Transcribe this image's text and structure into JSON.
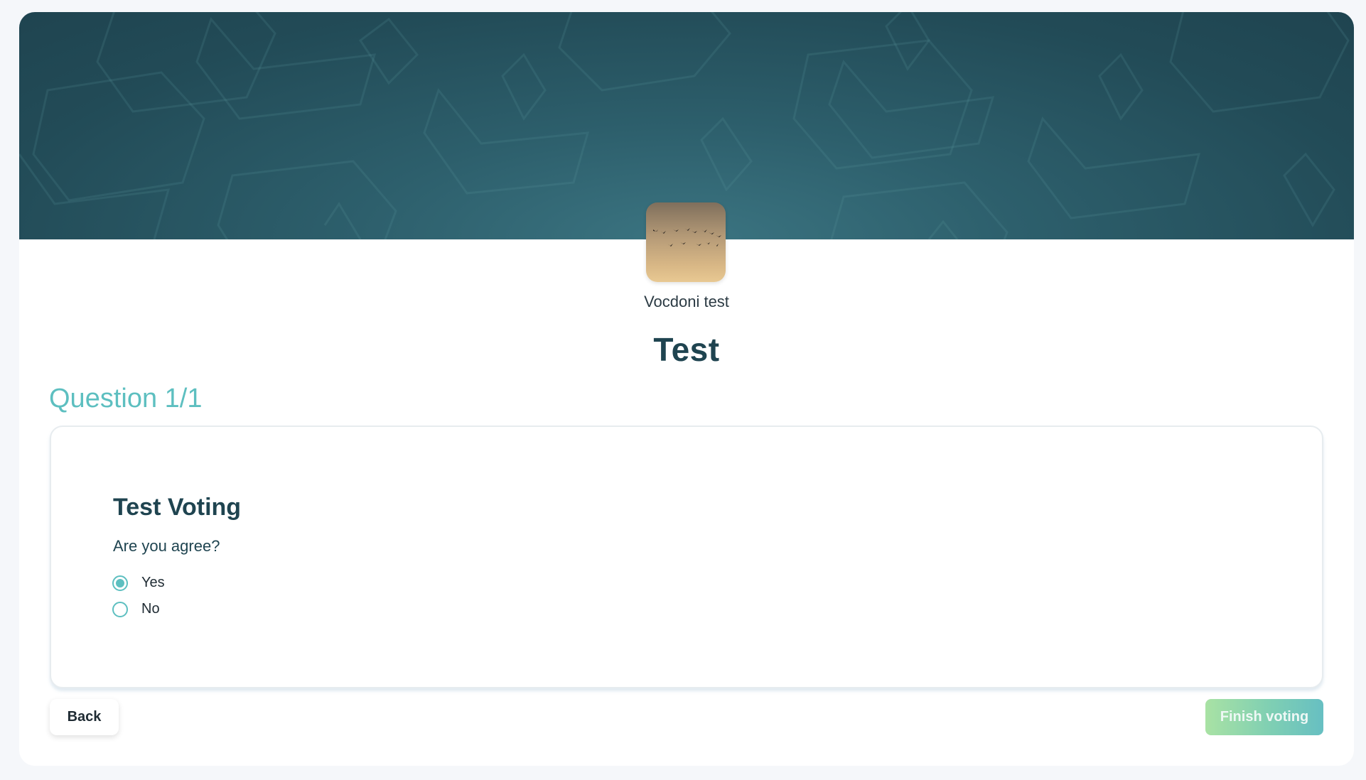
{
  "organization": {
    "name": "Vocdoni test",
    "avatar_icon": "birds-flock-sunset-image"
  },
  "process": {
    "title": "Test"
  },
  "question": {
    "counter": "Question 1/1",
    "title": "Test Voting",
    "description": "Are you agree?",
    "options": [
      {
        "label": "Yes",
        "selected": true
      },
      {
        "label": "No",
        "selected": false
      }
    ]
  },
  "actions": {
    "back_label": "Back",
    "finish_label": "Finish voting"
  },
  "colors": {
    "accent": "#5dbfc0",
    "banner": "#224b57",
    "title": "#1f4450"
  }
}
